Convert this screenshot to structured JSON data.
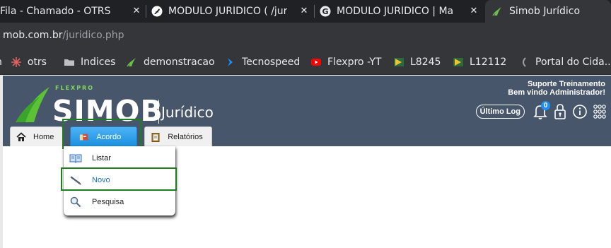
{
  "browser": {
    "tabs": [
      {
        "label": "Fila - Chamado - OTRS",
        "icon": "otrs-icon"
      },
      {
        "label": "MÓDULO JURÍDICO ( /jur",
        "icon": "feather-logo-icon"
      },
      {
        "label": "MÓDULO JURÍDICO | Ma",
        "icon": "google-g-icon"
      },
      {
        "label": "Simob Jurídico",
        "icon": "simob-leaf-icon"
      }
    ],
    "url": {
      "host": "mob.com.br",
      "path": "/juridico.php"
    },
    "bookmarks": [
      {
        "label": "otrs",
        "icon": "otrs-icon"
      },
      {
        "label": "Indices",
        "icon": "folder-icon"
      },
      {
        "label": "demonstracao",
        "icon": "simob-leaf-icon"
      },
      {
        "label": "Tecnospeed",
        "icon": "tecnospeed-icon"
      },
      {
        "label": "Flexpro -YT",
        "icon": "youtube-icon"
      },
      {
        "label": "L8245",
        "icon": "terminal-icon"
      },
      {
        "label": "L12112",
        "icon": "terminal-icon"
      },
      {
        "label": "Portal do Cida...",
        "icon": "portal-icon"
      }
    ]
  },
  "app": {
    "logo": {
      "brand": "FLEXPRO",
      "name": "SIMOB",
      "module": "Jurídico"
    },
    "user": {
      "line1": "Suporte Treinamento",
      "line2": "Bem vindo Administrador!"
    },
    "ultimo_log": "Último Log",
    "notification_count": "0",
    "nav": [
      {
        "label": "Home",
        "icon": "home-icon"
      },
      {
        "label": "Acordo",
        "icon": "handshake-icon"
      },
      {
        "label": "Relatórios",
        "icon": "clipboard-icon"
      }
    ],
    "menu": [
      {
        "label": "Listar",
        "icon": "book-icon"
      },
      {
        "label": "Novo",
        "icon": "pen-icon"
      },
      {
        "label": "Pesquisa",
        "icon": "magnifier-icon"
      }
    ]
  },
  "colors": {
    "header": "#48566c",
    "active_tab": "#1a8fe0",
    "highlight": "#1f7d1f",
    "brand_green": "#7ed957"
  }
}
